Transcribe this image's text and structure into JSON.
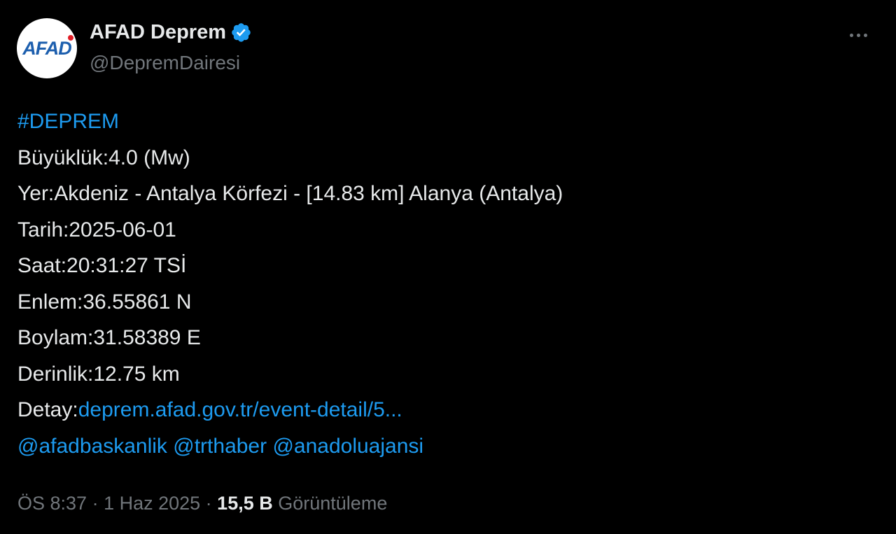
{
  "author": {
    "avatar_text": "AFAD",
    "display_name": "AFAD Deprem",
    "handle": "@DepremDairesi"
  },
  "tweet": {
    "hashtag": "#DEPREM",
    "lines": [
      "Büyüklük:4.0 (Mw)",
      "Yer:Akdeniz - Antalya Körfezi - [14.83 km] Alanya (Antalya)",
      "Tarih:2025-06-01",
      "Saat:20:31:27 TSİ",
      "Enlem:36.55861 N",
      "Boylam:31.58389 E",
      "Derinlik:12.75 km"
    ],
    "detail_label": "Detay:",
    "detail_link": "deprem.afad.gov.tr/event-detail/5...",
    "mentions": [
      "@afadbaskanlik",
      "@trthaber",
      "@anadoluajansi"
    ]
  },
  "meta": {
    "time": "ÖS 8:37",
    "separator": " · ",
    "date": "1 Haz 2025",
    "views_count": "15,5 B",
    "views_label": "Görüntüleme"
  },
  "colors": {
    "background": "#000000",
    "text": "#e7e9ea",
    "secondary": "#71767b",
    "link": "#1d9bf0",
    "verified": "#1d9bf0"
  }
}
